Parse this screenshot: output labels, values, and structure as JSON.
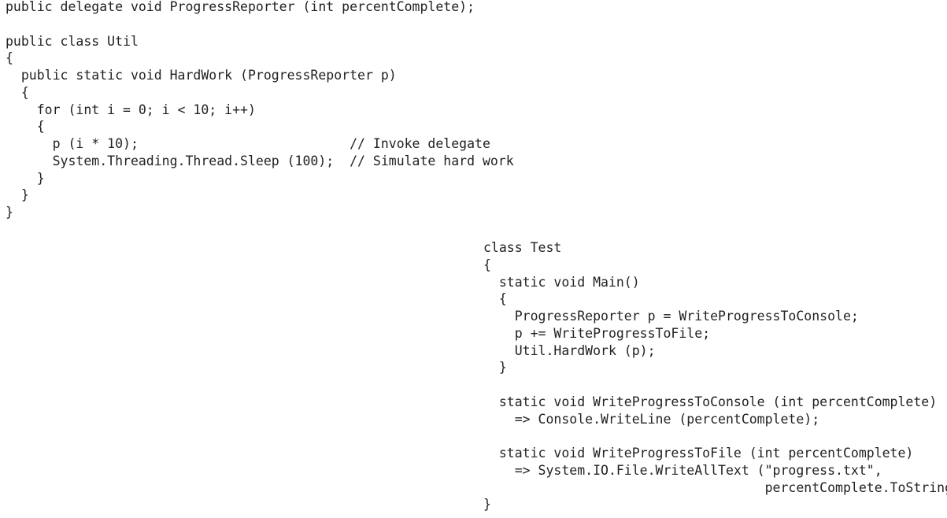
{
  "util_block": {
    "lines": [
      "public delegate void ProgressReporter (int percentComplete);",
      "",
      "public class Util",
      "{",
      "  public static void HardWork (ProgressReporter p)",
      "  {",
      "    for (int i = 0; i < 10; i++)",
      "    {",
      "      p (i * 10);                           // Invoke delegate",
      "      System.Threading.Thread.Sleep (100);  // Simulate hard work",
      "    }",
      "  }",
      "}"
    ]
  },
  "test_block": {
    "lines": [
      "class Test",
      "{",
      "  static void Main()",
      "  {",
      "    ProgressReporter p = WriteProgressToConsole;",
      "    p += WriteProgressToFile;",
      "    Util.HardWork (p);",
      "  }",
      "",
      "  static void WriteProgressToConsole (int percentComplete)",
      "    => Console.WriteLine (percentComplete);",
      "",
      "  static void WriteProgressToFile (int percentComplete)",
      "    => System.IO.File.WriteAllText (\"progress.txt\",",
      "                                    percentComplete.ToString());",
      "}"
    ]
  }
}
